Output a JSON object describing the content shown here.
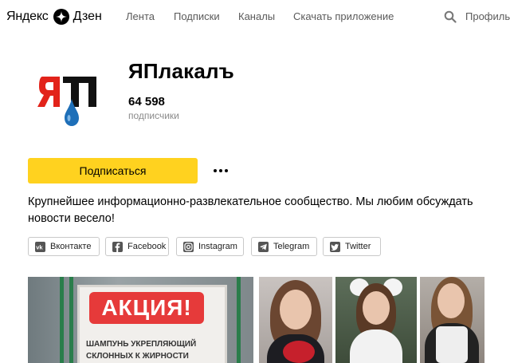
{
  "header": {
    "logo": {
      "yandex": "Яндекс",
      "zen": "Дзен"
    },
    "nav": [
      {
        "label": "Лента"
      },
      {
        "label": "Подписки"
      },
      {
        "label": "Каналы"
      },
      {
        "label": "Скачать приложение"
      }
    ],
    "search_icon": "search-icon",
    "profile": "Профиль"
  },
  "channel": {
    "avatar_icon": "yaplakal-logo",
    "title": "ЯПлакалъ",
    "subscribers_count": "64 598",
    "subscribers_label": "подписчики",
    "subscribe_label": "Подписаться",
    "more_icon": "more-dots-icon",
    "description": "Крупнейшее информационно-развлекательное сообщество. Мы любим обсуждать новости весело!"
  },
  "socials": [
    {
      "label": "Вконтакте",
      "icon": "vk-icon"
    },
    {
      "label": "Facebook",
      "icon": "facebook-icon"
    },
    {
      "label": "Instagram",
      "icon": "instagram-icon"
    },
    {
      "label": "Telegram",
      "icon": "telegram-icon"
    },
    {
      "label": "Twitter",
      "icon": "twitter-icon"
    }
  ],
  "cards": [
    {
      "sign_text": "АКЦИЯ!",
      "caption_lines": [
        "ШАМПУНЬ УКРЕПЛЯЮЩИЙ",
        "СКЛОННЫХ К ЖИРНОСТИ"
      ]
    },
    {
      "kind": "photo-collage"
    }
  ],
  "colors": {
    "subscribe_bg": "#ffd21f",
    "nav_text": "#5a5a5a",
    "promo_red": "#e63a3a",
    "logo_red": "#e2231a",
    "logo_blue": "#1e6fb8"
  }
}
